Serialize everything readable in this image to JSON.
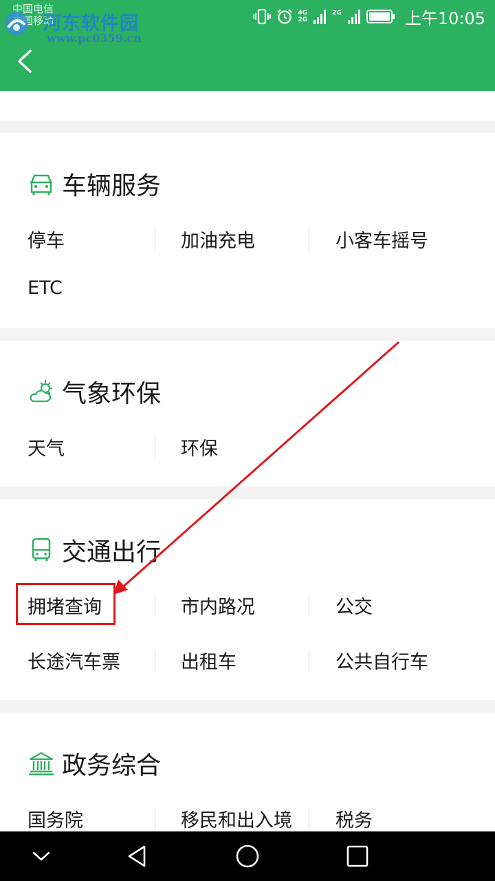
{
  "status_bar": {
    "carrier_line1": "中国电信",
    "carrier_line2": "中国移动",
    "net_top": "4G",
    "net_bottom": "2G",
    "net2": "2G",
    "time": "上午10:05",
    "watermark_text": "河东软件园",
    "watermark_url": "www.pc0359.cn"
  },
  "colors": {
    "header": "#2cb160",
    "accent": "#2cb160",
    "highlight": "#e0191f"
  },
  "sections": [
    {
      "title": "车辆服务",
      "icon": "car-icon",
      "items": [
        "停车",
        "加油充电",
        "小客车摇号",
        "ETC"
      ]
    },
    {
      "title": "气象环保",
      "icon": "weather-icon",
      "items": [
        "天气",
        "环保"
      ]
    },
    {
      "title": "交通出行",
      "icon": "bus-icon",
      "items": [
        "拥堵查询",
        "市内路况",
        "公交",
        "长途汽车票",
        "出租车",
        "公共自行车"
      ]
    },
    {
      "title": "政务综合",
      "icon": "government-icon",
      "items": [
        "国务院",
        "移民和出入境",
        "税务"
      ]
    }
  ]
}
